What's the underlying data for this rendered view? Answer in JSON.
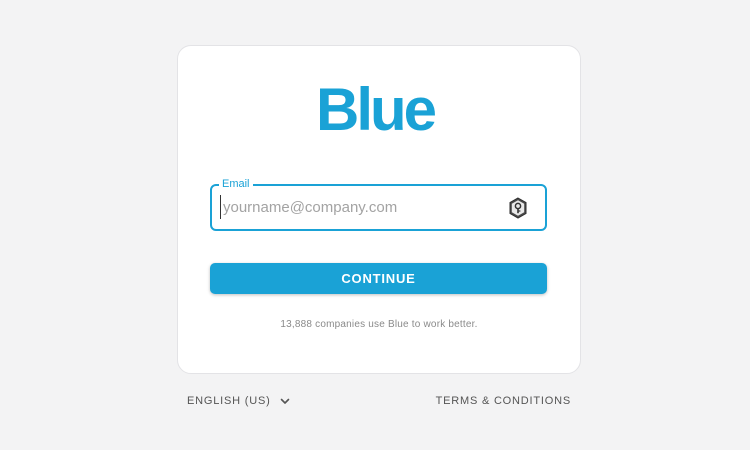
{
  "logo": {
    "text": "Blue"
  },
  "email": {
    "label": "Email",
    "placeholder": "yourname@company.com",
    "value": ""
  },
  "continue": {
    "label": "CONTINUE"
  },
  "tagline": "13,888 companies use Blue to work better.",
  "footer": {
    "language": "ENGLISH (US)",
    "terms": "TERMS & CONDITIONS"
  },
  "colors": {
    "brand": "#1aa2d6",
    "background": "#f3f3f4",
    "card": "#ffffff"
  },
  "icons": {
    "password_manager": "key-icon",
    "language_dropdown": "chevron-down-icon"
  }
}
